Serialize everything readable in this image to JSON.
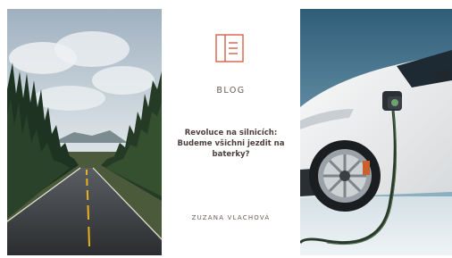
{
  "card": {
    "category": "BLOG",
    "headline": "Revoluce na silnicích: Budeme všichni jezdit na baterky?",
    "author": "ZUZANA VLACHOVÁ"
  },
  "images": {
    "left": "forest-road-photo",
    "right": "electric-car-charging-photo"
  },
  "icons": {
    "blog": "document-list-icon"
  },
  "colors": {
    "accent": "#d9614a",
    "text": "#4d403c",
    "muted": "#6a5a55"
  }
}
